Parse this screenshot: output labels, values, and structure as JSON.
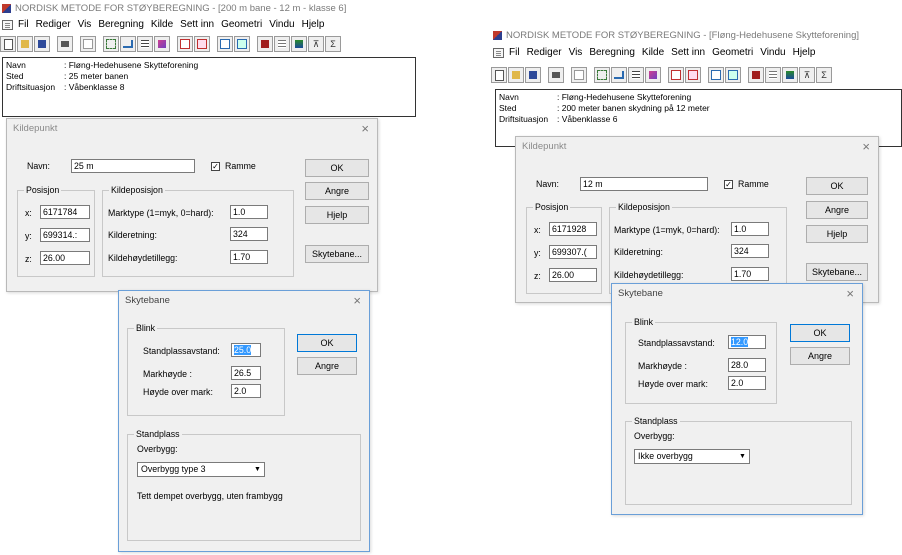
{
  "left": {
    "title": "NORDISK METODE FOR STØYBEREGNING - [200 m bane - 12 m - klasse 6]",
    "menu": [
      "Fil",
      "Rediger",
      "Vis",
      "Beregning",
      "Kilde",
      "Sett inn",
      "Geometri",
      "Vindu",
      "Hjelp"
    ],
    "info": [
      {
        "key": "Navn",
        "val": ": Fløng-Hedehusene Skytteforening"
      },
      {
        "key": "Sted",
        "val": ": 25 meter banen"
      },
      {
        "key": "Driftsituasjon",
        "val": ": Våbenklasse 8"
      }
    ],
    "kildepunkt": {
      "title": "Kildepunkt",
      "navn_label": "Navn:",
      "navn": "25 m",
      "ramme": "Ramme",
      "ramme_mark": "✓",
      "posisjon": "Posisjon",
      "x_label": "x:",
      "x": "6171784",
      "y_label": "y:",
      "y": "699314.:",
      "z_label": "z:",
      "z": "26.00",
      "kildeposisjon": "Kildeposisjon",
      "marktype_label": "Marktype (1=myk, 0=hard):",
      "marktype": "1.0",
      "retning_label": "Kilderetning:",
      "retning": "324",
      "hoyde_label": "Kildehøydetillegg:",
      "hoyde": "1.70",
      "ok": "OK",
      "angre": "Angre",
      "hjelp": "Hjelp",
      "skytebane": "Skytebane..."
    },
    "skytebane": {
      "title": "Skytebane",
      "blink": "Blink",
      "standplass_avstand_label": "Standplassavstand:",
      "standplass_avstand": "25.0",
      "markhoyde_label": "Markhøyde :",
      "markhoyde": "26.5",
      "hoyde_label": "Høyde over mark:",
      "hoyde": "2.0",
      "standplass": "Standplass",
      "overbygg_label": "Overbygg:",
      "overbygg": "Overbygg type 3",
      "desc": "Tett dempet overbygg, uten frambygg",
      "ok": "OK",
      "angre": "Angre"
    }
  },
  "right": {
    "title": "NORDISK METODE FOR STØYBEREGNING - [Fløng-Hedehusene Skytteforening]",
    "menu": [
      "Fil",
      "Rediger",
      "Vis",
      "Beregning",
      "Kilde",
      "Sett inn",
      "Geometri",
      "Vindu",
      "Hjelp"
    ],
    "info": [
      {
        "key": "Navn",
        "val": ": Fløng-Hedehusene Skytteforening"
      },
      {
        "key": "Sted",
        "val": ": 200 meter banen  skydning på 12 meter"
      },
      {
        "key": "Driftsituasjon",
        "val": ": Våbenklasse 6"
      }
    ],
    "kildepunkt": {
      "title": "Kildepunkt",
      "navn_label": "Navn:",
      "navn": "12 m",
      "ramme": "Ramme",
      "ramme_mark": "✓",
      "posisjon": "Posisjon",
      "x_label": "x:",
      "x": "6171928",
      "y_label": "y:",
      "y": "699307.(",
      "z_label": "z:",
      "z": "26.00",
      "kildeposisjon": "Kildeposisjon",
      "marktype_label": "Marktype (1=myk, 0=hard):",
      "marktype": "1.0",
      "retning_label": "Kilderetning:",
      "retning": "324",
      "hoyde_label": "Kildehøydetillegg:",
      "hoyde": "1.70",
      "ok": "OK",
      "angre": "Angre",
      "hjelp": "Hjelp",
      "skytebane": "Skytebane..."
    },
    "skytebane": {
      "title": "Skytebane",
      "blink": "Blink",
      "standplass_avstand_label": "Standplassavstand:",
      "standplass_avstand": "12.0",
      "markhoyde_label": "Markhøyde :",
      "markhoyde": "28.0",
      "hoyde_label": "Høyde over mark:",
      "hoyde": "2.0",
      "standplass": "Standplass",
      "overbygg_label": "Overbygg:",
      "overbygg": "Ikke overbygg",
      "ok": "OK",
      "angre": "Angre"
    }
  },
  "toolbar_glyphs": [
    "D",
    "▣",
    "▪",
    "⎙",
    "▤",
    "⋰",
    "▬",
    "▦",
    "▨",
    "⊞",
    "⊡",
    "▭",
    "▢",
    "▙",
    "▥",
    "▧",
    "⊼",
    "Σ"
  ]
}
